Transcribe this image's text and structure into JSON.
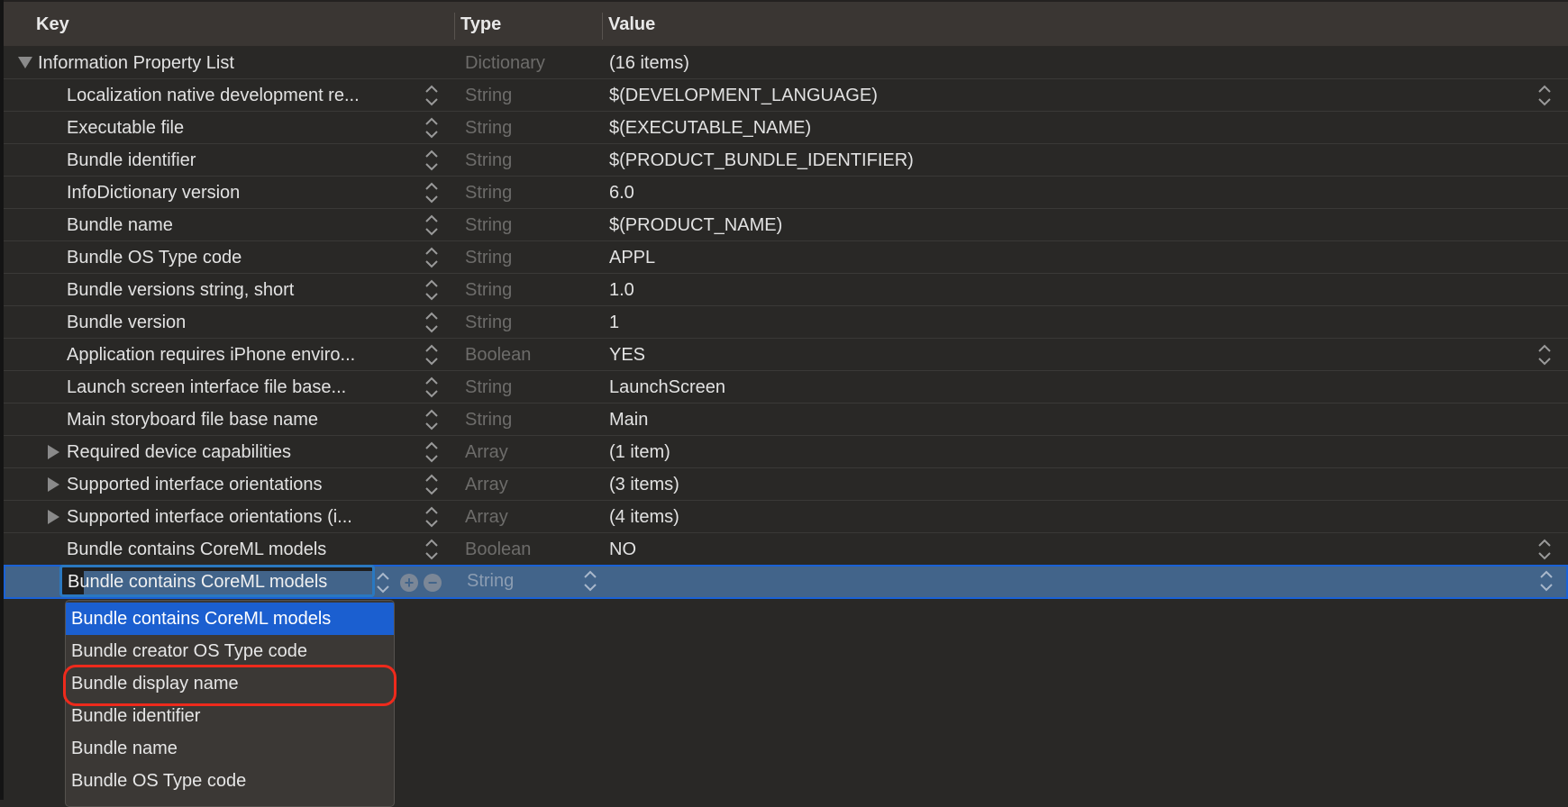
{
  "header": {
    "key": "Key",
    "type": "Type",
    "value": "Value"
  },
  "root": {
    "key": "Information Property List",
    "type": "Dictionary",
    "value": "(16 items)",
    "expanded": true
  },
  "rows": [
    {
      "key": "Localization native development re...",
      "type": "String",
      "value": "$(DEVELOPMENT_LANGUAGE)",
      "value_stepper": true
    },
    {
      "key": "Executable file",
      "type": "String",
      "value": "$(EXECUTABLE_NAME)"
    },
    {
      "key": "Bundle identifier",
      "type": "String",
      "value": "$(PRODUCT_BUNDLE_IDENTIFIER)"
    },
    {
      "key": "InfoDictionary version",
      "type": "String",
      "value": "6.0"
    },
    {
      "key": "Bundle name",
      "type": "String",
      "value": "$(PRODUCT_NAME)"
    },
    {
      "key": "Bundle OS Type code",
      "type": "String",
      "value": "APPL"
    },
    {
      "key": "Bundle versions string, short",
      "type": "String",
      "value": "1.0"
    },
    {
      "key": "Bundle version",
      "type": "String",
      "value": "1"
    },
    {
      "key": "Application requires iPhone enviro...",
      "type": "Boolean",
      "value": "YES",
      "value_stepper": true
    },
    {
      "key": "Launch screen interface file base...",
      "type": "String",
      "value": "LaunchScreen"
    },
    {
      "key": "Main storyboard file base name",
      "type": "String",
      "value": "Main"
    },
    {
      "key": "Required device capabilities",
      "type": "Array",
      "value": "(1 item)",
      "collapsed": true
    },
    {
      "key": "Supported interface orientations",
      "type": "Array",
      "value": "(3 items)",
      "collapsed": true
    },
    {
      "key": "Supported interface orientations (i...",
      "type": "Array",
      "value": "(4 items)",
      "collapsed": true
    },
    {
      "key": "Bundle contains CoreML models",
      "type": "Boolean",
      "value": "NO",
      "value_stepper": true
    }
  ],
  "editing_row": {
    "key": "Bundle contains CoreML models",
    "type": "String",
    "value": ""
  },
  "dropdown": {
    "items": [
      "Bundle contains CoreML models",
      "Bundle creator OS Type code",
      "Bundle display name",
      "Bundle identifier",
      "Bundle name",
      "Bundle OS Type code"
    ],
    "highlighted_index": 0,
    "annotated_index": 2
  },
  "colors": {
    "selection": "#42648a",
    "highlight": "#1b5fd0",
    "annotation": "#ee2a1c"
  }
}
